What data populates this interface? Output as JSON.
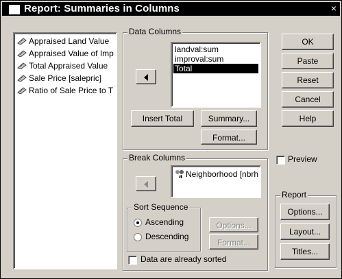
{
  "window": {
    "title": "Report: Summaries in Columns",
    "close_glyph": "×"
  },
  "variables": [
    {
      "label": "Appraised Land Value",
      "icon": "ruler-icon"
    },
    {
      "label": "Appraised Value of Imp",
      "icon": "ruler-icon"
    },
    {
      "label": "Total Appraised Value",
      "icon": "ruler-icon"
    },
    {
      "label": "Sale Price [salepric]",
      "icon": "ruler-icon"
    },
    {
      "label": "Ratio of Sale Price to T",
      "icon": "ruler-icon"
    }
  ],
  "data_columns": {
    "label": "Data Columns",
    "items": [
      "landval:sum",
      "improval:sum",
      "Total"
    ],
    "selected_index": 2,
    "insert_total_label": "Insert Total",
    "summary_label": "Summary...",
    "format_label": "Format..."
  },
  "buttons": {
    "ok": "OK",
    "paste": "Paste",
    "reset": "Reset",
    "cancel": "Cancel",
    "help": "Help"
  },
  "break_columns": {
    "label": "Break Columns",
    "items": [
      "Neighborhood [nbrh"
    ],
    "sort_sequence_label": "Sort Sequence",
    "ascending_label": "Ascending",
    "descending_label": "Descending",
    "selected_sort": "Ascending",
    "options_label": "Options...",
    "format_label": "Format...",
    "already_sorted_label": "Data are already sorted",
    "already_sorted_checked": false
  },
  "preview": {
    "label": "Preview",
    "checked": false
  },
  "report_group": {
    "label": "Report",
    "options_label": "Options...",
    "layout_label": "Layout...",
    "titles_label": "Titles..."
  }
}
